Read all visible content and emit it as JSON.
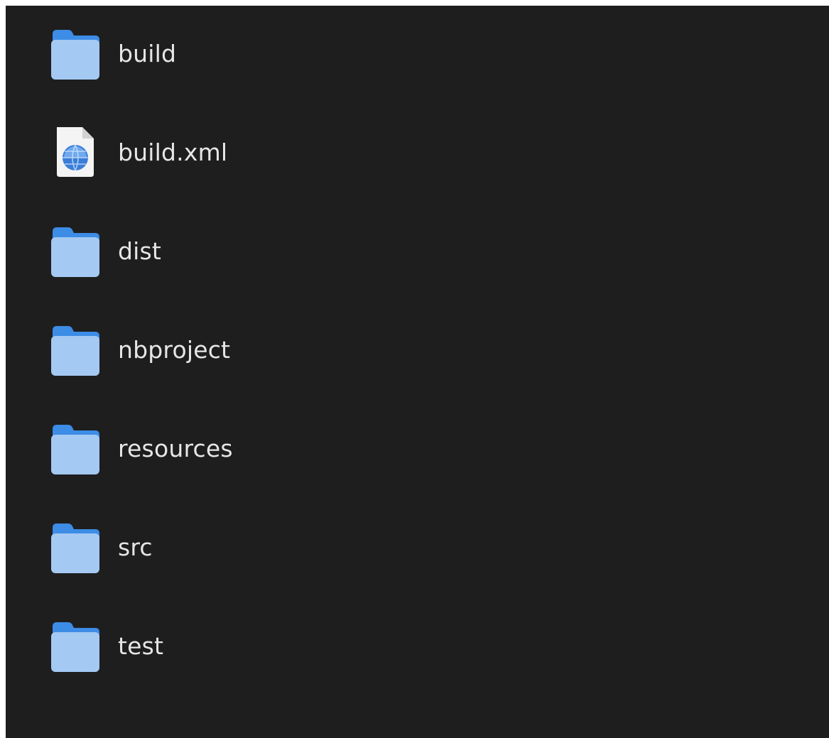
{
  "files": [
    {
      "name": "build",
      "icon": "folder-icon"
    },
    {
      "name": "build.xml",
      "icon": "xml-file-icon"
    },
    {
      "name": "dist",
      "icon": "folder-icon"
    },
    {
      "name": "nbproject",
      "icon": "folder-icon"
    },
    {
      "name": "resources",
      "icon": "folder-icon"
    },
    {
      "name": "src",
      "icon": "folder-icon"
    },
    {
      "name": "test",
      "icon": "folder-icon"
    }
  ],
  "colors": {
    "background": "#1e1e1e",
    "folder_back": "#3d8ce6",
    "folder_front": "#a4c9f2",
    "text": "#e6e6e6"
  }
}
